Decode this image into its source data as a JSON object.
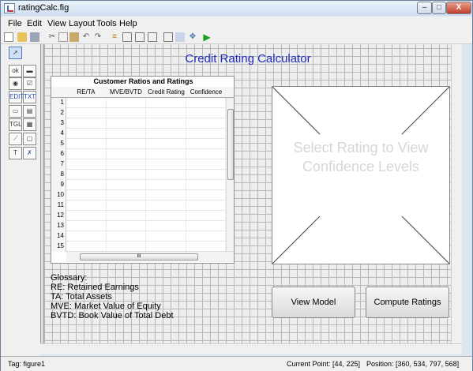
{
  "window": {
    "title": "ratingCalc.fig",
    "controls": {
      "minimize": "–",
      "maximize": "□",
      "close": "X"
    }
  },
  "menu": [
    "File",
    "Edit",
    "View",
    "Layout",
    "Tools",
    "Help"
  ],
  "toolbar_icons": [
    "new-file-icon",
    "open-folder-icon",
    "save-icon",
    "cut-icon",
    "copy-icon",
    "paste-icon",
    "undo-icon",
    "redo-icon",
    "align-icon",
    "menu-editor-icon",
    "tab-order-icon",
    "toolbar-editor-icon",
    "mfile-editor-icon",
    "property-inspector-icon",
    "object-browser-icon",
    "run-icon"
  ],
  "palette_icons": [
    "select-arrow-icon",
    "push-button-icon",
    "slider-icon",
    "radio-button-icon",
    "checkbox-icon",
    "edit-text-icon",
    "static-text-icon",
    "popup-menu-icon",
    "listbox-icon",
    "toggle-button-icon",
    "table-icon",
    "axes-icon",
    "panel-icon",
    "button-group-icon",
    "activex-icon"
  ],
  "gui": {
    "title": "Credit Rating Calculator",
    "table": {
      "title": "Customer Ratios and Ratings",
      "columns": [
        "RE/TA",
        "MVE/BVTD",
        "Credit Rating",
        "Confidence"
      ],
      "row_numbers": [
        "1",
        "2",
        "3",
        "4",
        "5",
        "6",
        "7",
        "8",
        "9",
        "10",
        "11",
        "12",
        "13",
        "14",
        "15"
      ],
      "hscroll_grip": "III"
    },
    "glossary": [
      "Glossary:",
      "RE: Retained Earnings",
      "TA: Total Assets",
      "MVE: Market Value of Equity",
      "BVTD: Book Value of Total Debt"
    ],
    "axes_placeholder": "Select Rating to View Confidence Levels",
    "buttons": {
      "view_model": "View Model",
      "compute_ratings": "Compute Ratings"
    }
  },
  "status": {
    "tag": "Tag: figure1",
    "current_point": "Current Point:  [44, 225]",
    "position": "Position: [360, 534, 797, 568]"
  }
}
